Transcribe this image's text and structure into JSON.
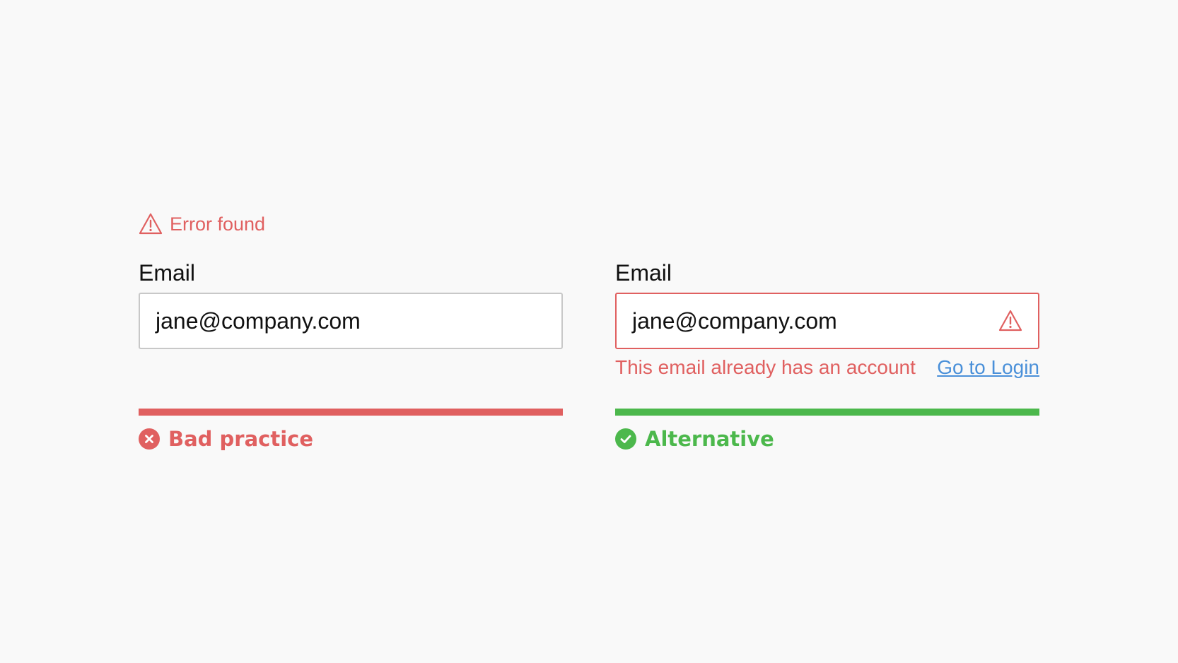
{
  "colors": {
    "error": "#e06060",
    "success": "#4cb84c",
    "link": "#4a90d9",
    "text": "#111111",
    "input_border": "#c8c8c8",
    "background": "#f9f9f9"
  },
  "bad_example": {
    "error_banner": {
      "icon": "warning-icon",
      "text": "Error found"
    },
    "field": {
      "label": "Email",
      "value": "jane@company.com"
    },
    "verdict": {
      "icon": "x-circle-icon",
      "label": "Bad practice"
    }
  },
  "good_example": {
    "field": {
      "label": "Email",
      "value": "jane@company.com",
      "icon": "warning-icon"
    },
    "helper": {
      "text": "This email already has an account",
      "link_text": "Go to Login"
    },
    "verdict": {
      "icon": "check-circle-icon",
      "label": "Alternative"
    }
  }
}
